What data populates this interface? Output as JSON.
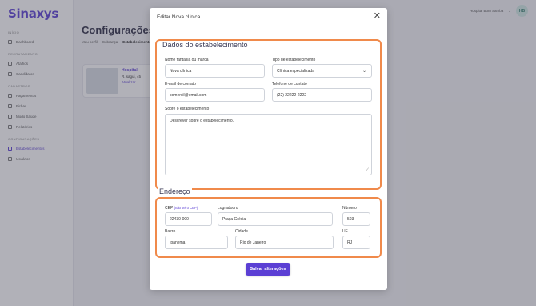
{
  "app": {
    "logo": "Sinaxys",
    "sidebar": {
      "sections": [
        {
          "title": "INÍCIO",
          "items": [
            "Dashboard"
          ]
        },
        {
          "title": "RECRUTAMENTO",
          "items": [
            "Atalhos",
            "Candidatos"
          ]
        },
        {
          "title": "CADASTROS",
          "items": [
            "Pagamentos",
            "Fichas",
            "Modo Saúde",
            "Relatórios"
          ]
        },
        {
          "title": "CONFIGURAÇÕES",
          "items": [
            "Estabelecimentos",
            "Usuários"
          ]
        }
      ]
    },
    "user": {
      "name": "Hospital Bom Samba",
      "initials": "HB"
    },
    "page_title": "Configurações",
    "tabs": [
      "Meu perfil",
      "Cobrança",
      "Estabelecimentos"
    ],
    "card": {
      "title": "Hospital",
      "line": "R. sagui, 45",
      "link": "Atualizar"
    }
  },
  "modal": {
    "title": "Editar Nova clínica",
    "close_icon": "close-icon",
    "establishment": {
      "section_title": "Dados do estabelecimento",
      "name_label": "Nome fantasia ou marca",
      "name_value": "Nova clínica",
      "type_label": "Tipo de estabelecimento",
      "type_value": "Clínica especializada",
      "email_label": "E-mail de contato",
      "email_value": "comercil@email.com",
      "phone_label": "Telefone de contato",
      "phone_value": "(22) 22222-2222",
      "about_label": "Sobre o estabelecimento",
      "about_value": "Descrever sobre o estabelecimento."
    },
    "address": {
      "section_title": "Endereço",
      "cep_label": "CEP",
      "cep_hint": "(não sei o CEP)",
      "cep_value": "22430-000",
      "street_label": "Logradouro",
      "street_value": "Praça Grécia",
      "number_label": "Número",
      "number_value": "503",
      "district_label": "Bairro",
      "district_value": "Ipanema",
      "city_label": "Cidade",
      "city_value": "Rio de Janeiro",
      "uf_label": "UF",
      "uf_value": "RJ"
    },
    "save_label": "Salvar alterações"
  },
  "colors": {
    "accent": "#5b3fd4",
    "highlight": "#f08a4b"
  }
}
